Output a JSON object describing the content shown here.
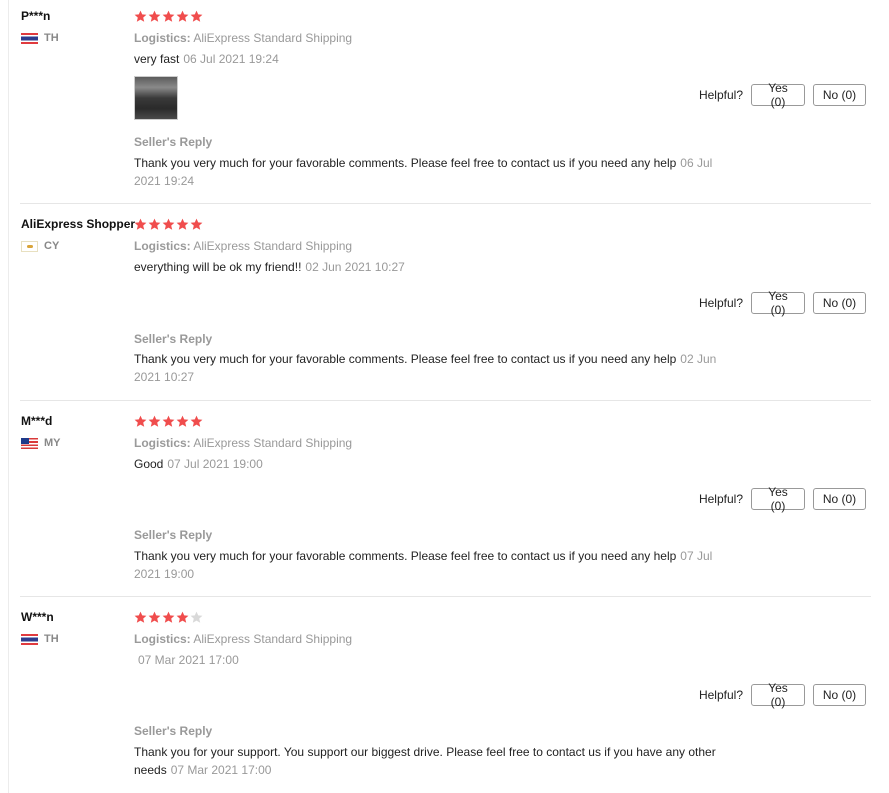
{
  "helpful_label": "Helpful?",
  "logistics_label": "Logistics:",
  "seller_reply_label": "Seller's Reply",
  "colors": {
    "star_on": "#f04d4d",
    "star_off": "#d9d9d9",
    "muted": "#999999"
  },
  "reviews": [
    {
      "user": "P***n",
      "country": "TH",
      "flag": "thailand-flag-icon",
      "rating": 5,
      "logistics": "AliExpress Standard Shipping",
      "text": "very fast",
      "date": "06 Jul 2021 19:24",
      "has_photo": true,
      "yes": "Yes (0)",
      "no": "No (0)",
      "reply": "Thank you very much for your favorable comments. Please feel free to contact us if you need any help",
      "reply_date": "06 Jul 2021 19:24"
    },
    {
      "user": "AliExpress Shopper",
      "country": "CY",
      "flag": "cyprus-flag-icon",
      "rating": 5,
      "logistics": "AliExpress Standard Shipping",
      "text": "everything will be ok my friend!!",
      "date": "02 Jun 2021 10:27",
      "has_photo": false,
      "yes": "Yes (0)",
      "no": "No (0)",
      "reply": "Thank you very much for your favorable comments. Please feel free to contact us if you need any help",
      "reply_date": "02 Jun 2021 10:27"
    },
    {
      "user": "M***d",
      "country": "MY",
      "flag": "malaysia-flag-icon",
      "rating": 5,
      "logistics": "AliExpress Standard Shipping",
      "text": "Good",
      "date": "07 Jul 2021 19:00",
      "has_photo": false,
      "yes": "Yes (0)",
      "no": "No (0)",
      "reply": "Thank you very much for your favorable comments. Please feel free to contact us if you need any help",
      "reply_date": "07 Jul 2021 19:00"
    },
    {
      "user": "W***n",
      "country": "TH",
      "flag": "thailand-flag-icon",
      "rating": 4,
      "logistics": "AliExpress Standard Shipping",
      "text": "",
      "date": "07 Mar 2021 17:00",
      "has_photo": false,
      "yes": "Yes (0)",
      "no": "No (0)",
      "reply": "Thank you for your support. You support our biggest drive. Please feel free to contact us if you have any other needs",
      "reply_date": "07 Mar 2021 17:00"
    }
  ]
}
